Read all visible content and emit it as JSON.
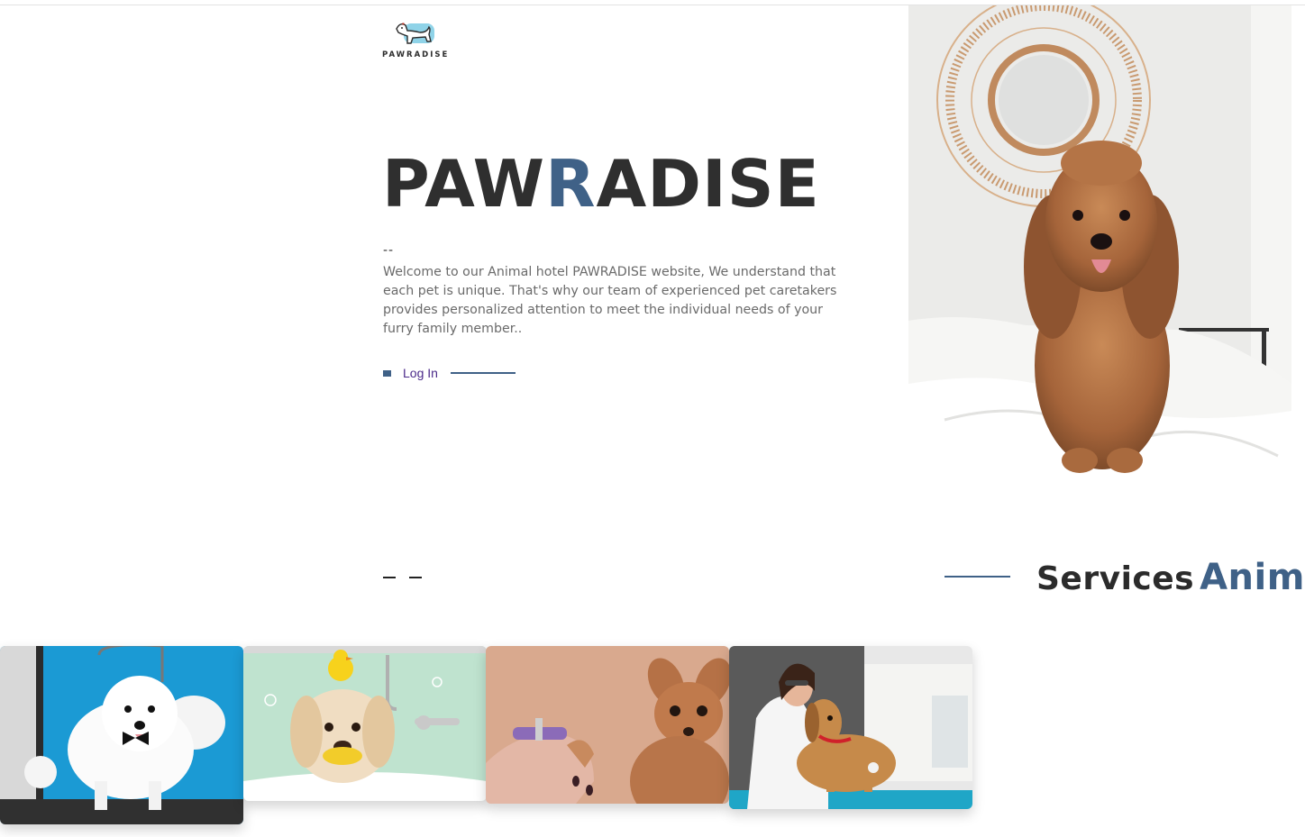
{
  "brand": {
    "logo_text": "PAWRADISE",
    "logo_icon": "dog-logo-icon"
  },
  "hero": {
    "title_part1": "PAW",
    "title_accent": "R",
    "title_part2": "ADISE",
    "divider": "--",
    "description": "Welcome to our Animal hotel PAWRADISE website, We understand that each pet is unique. That's why our team of experienced pet caretakers provides personalized attention to meet the individual needs of your furry family member..",
    "login_label": "Log In",
    "photo": "dog-on-bed-photo"
  },
  "services": {
    "title": "Services",
    "title_accent": "Anima",
    "cards": [
      {
        "photo": "grooming-poodle-photo"
      },
      {
        "photo": "bath-dog-duck-photo"
      },
      {
        "photo": "nail-trim-chihuahua-photo"
      },
      {
        "photo": "vet-checkup-dog-photo"
      }
    ]
  },
  "colors": {
    "accent": "#3f6187",
    "text_dark": "#2f2f2f",
    "text_muted": "#6a6a6a",
    "link": "#4b2a8a"
  }
}
